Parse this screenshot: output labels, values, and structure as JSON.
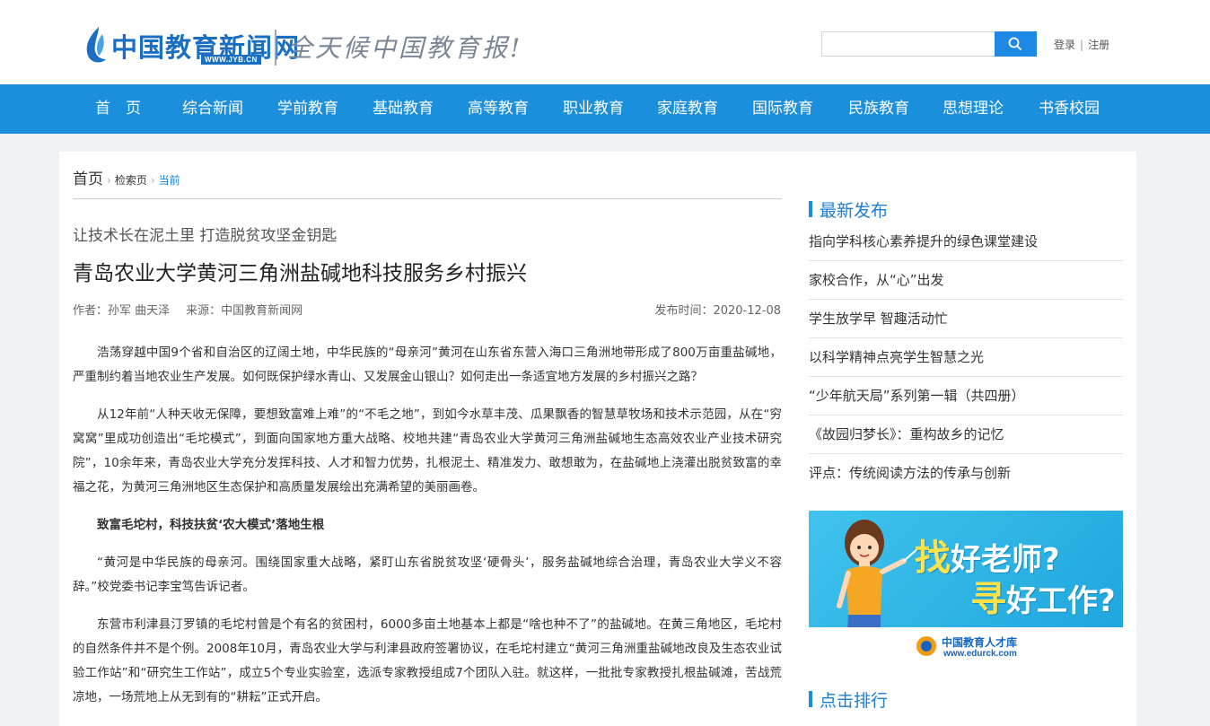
{
  "header": {
    "logo_text": "中国教育新闻网",
    "logo_url": "WWW.JYB.CN",
    "slogan": "全天候中国教育报!",
    "search_placeholder": "",
    "login": "登录",
    "separator": "|",
    "register": "注册"
  },
  "nav": {
    "items": [
      "首　页",
      "综合新闻",
      "学前教育",
      "基础教育",
      "高等教育",
      "职业教育",
      "家庭教育",
      "国际教育",
      "民族教育",
      "思想理论",
      "书香校园"
    ]
  },
  "breadcrumb": {
    "home": "首页",
    "search": "检索页",
    "current": "当前"
  },
  "article": {
    "subtitle": "让技术长在泥土里 打造脱贫攻坚金钥匙",
    "title": "青岛农业大学黄河三角洲盐碱地科技服务乡村振兴",
    "author": "作者：孙军 曲天泽",
    "source": "来源：中国教育新闻网",
    "pubtime": "发布时间：2020-12-08",
    "paragraphs": [
      "浩荡穿越中国9个省和自治区的辽阔土地，中华民族的“母亲河”黄河在山东省东营入海口三角洲地带形成了800万亩重盐碱地，严重制约着当地农业生产发展。如何既保护绿水青山、又发展金山银山？如何走出一条适宜地方发展的乡村振兴之路？",
      "从12年前“人种天收无保障，要想致富难上难”的“不毛之地”，到如今水草丰茂、瓜果飘香的智慧草牧场和技术示范园，从在“穷窝窝”里成功创造出“毛坨模式”，到面向国家地方重大战略、校地共建“青岛农业大学黄河三角洲盐碱地生态高效农业产业技术研究院”，10余年来，青岛农业大学充分发挥科技、人才和智力优势，扎根泥土、精准发力、敢想敢为，在盐碱地上浇灌出脱贫致富的幸福之花，为黄河三角洲地区生态保护和高质量发展绘出充满希望的美丽画卷。",
      "致富毛坨村，科技扶贫‘农大模式’落地生根",
      "“黄河是中华民族的母亲河。围绕国家重大战略，紧盯山东省脱贫攻坚‘硬骨头’，服务盐碱地综合治理，青岛农业大学义不容辞。”校党委书记李宝笃告诉记者。",
      "东营市利津县汀罗镇的毛坨村曾是个有名的贫困村，6000多亩土地基本上都是“啥也种不了”的盐碱地。在黄三角地区，毛坨村的自然条件并不是个例。2008年10月，青岛农业大学与利津县政府签署协议，在毛坨村建立“黄河三角洲重盐碱地改良及生态农业试验工作站”和“研究生工作站”，成立5个专业实验室，选派专家教授组成7个团队入驻。就这样，一批批专家教授扎根盐碱滩，苦战荒凉地，一场荒地上从无到有的“耕耘”正式开启。"
    ]
  },
  "sidebar": {
    "latest_title": "最新发布",
    "latest": [
      "指向学科核心素养提升的绿色课堂建设",
      "家校合作，从“心”出发",
      "学生放学早 智趣活动忙",
      "以科学精神点亮学生智慧之光",
      "“少年航天局”系列第一辑（共四册）",
      "《故园归梦长》：重构故乡的记忆",
      "评点：传统阅读方法的传承与创新"
    ],
    "ad": {
      "line1_big": "找",
      "line1": "好老师?",
      "line2_big": "寻",
      "line2": "好工作?",
      "brand": "中国教育人才库",
      "site": "www.edurck.com"
    },
    "ranking_title": "点击排行"
  },
  "colors": {
    "nav_bg": "#1b8fdc",
    "accent": "#1b7fd6",
    "search_button": "#1e88e5"
  }
}
